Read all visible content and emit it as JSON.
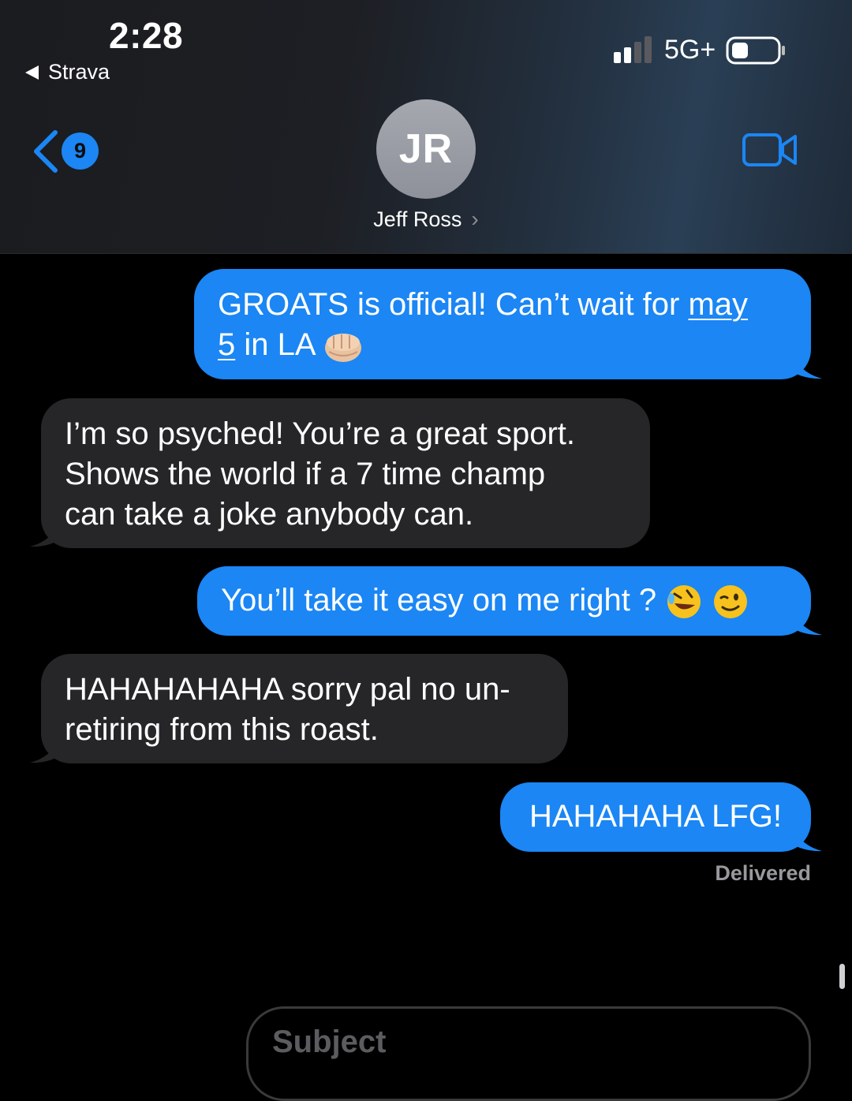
{
  "status_bar": {
    "time": "2:28",
    "back_app": "Strava",
    "network": "5G+"
  },
  "header": {
    "back_badge_count": "9",
    "avatar_initials": "JR",
    "contact_name": "Jeff Ross",
    "chevron": "›",
    "icons": {
      "back": "chevron-left-icon",
      "video": "video-camera-icon"
    }
  },
  "messages": [
    {
      "direction": "sent",
      "text_line1": "GROATS is official! Can’t wait for ",
      "link_part1": "may",
      "link_part2": "5",
      "text_line2_rest": " in LA",
      "emoji": "👊"
    },
    {
      "direction": "received",
      "lines": [
        "I’m so psyched! You’re a great sport.",
        "Shows the world if a 7 time champ",
        "can take a joke anybody can."
      ]
    },
    {
      "direction": "sent",
      "text": "You’ll take it easy on me right ?",
      "emojis": [
        "🤣",
        "😉"
      ]
    },
    {
      "direction": "received",
      "lines": [
        "HAHAHAHAHA sorry pal no un-",
        "retiring from this roast."
      ]
    },
    {
      "direction": "sent",
      "text": "HAHAHAHA LFG!"
    }
  ],
  "delivered_label": "Delivered",
  "compose": {
    "subject_placeholder": "Subject"
  },
  "colors": {
    "sent_bubble": "#1b86f4",
    "received_bubble": "#262628",
    "background": "#000000",
    "accent": "#1b86f4"
  }
}
